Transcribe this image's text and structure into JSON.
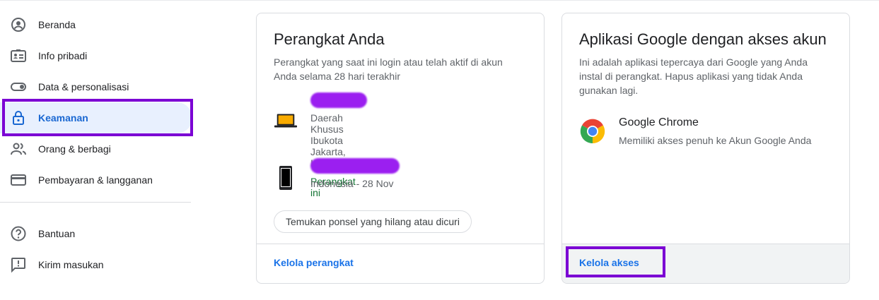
{
  "sidebar": {
    "items": [
      {
        "label": "Beranda",
        "icon": "home-account-icon"
      },
      {
        "label": "Info pribadi",
        "icon": "id-card-icon"
      },
      {
        "label": "Data & personalisasi",
        "icon": "toggle-icon"
      },
      {
        "label": "Keamanan",
        "icon": "lock-icon",
        "active": true
      },
      {
        "label": "Orang & berbagi",
        "icon": "people-icon"
      },
      {
        "label": "Pembayaran & langganan",
        "icon": "credit-card-icon"
      }
    ],
    "secondary": [
      {
        "label": "Bantuan",
        "icon": "help-icon"
      },
      {
        "label": "Kirim masukan",
        "icon": "feedback-icon"
      }
    ]
  },
  "devices_card": {
    "title": "Perangkat Anda",
    "description": "Perangkat yang saat ini login atau telah aktif di akun Anda selama 28 hari terakhir",
    "devices": [
      {
        "location": "Daerah Khusus Ibukota Jakarta, Indonesia",
        "status": "Perangkat ini",
        "icon": "laptop-icon"
      },
      {
        "location": "Indonesia - 28 Nov",
        "icon": "phone-icon"
      }
    ],
    "find_phone_button": "Temukan ponsel yang hilang atau dicuri",
    "footer_link": "Kelola perangkat"
  },
  "apps_card": {
    "title": "Aplikasi Google dengan akses akun",
    "description": "Ini adalah aplikasi tepercaya dari Google yang Anda instal di perangkat. Hapus aplikasi yang tidak Anda gunakan lagi.",
    "app": {
      "name": "Google Chrome",
      "access": "Memiliki akses penuh ke Akun Google Anda",
      "icon": "chrome-icon"
    },
    "footer_link": "Kelola akses"
  },
  "colors": {
    "accent": "#1a73e8",
    "active_bg": "#e8f0fe",
    "highlight": "#7b00d4",
    "redaction": "#9b1ff0",
    "success": "#137333"
  }
}
